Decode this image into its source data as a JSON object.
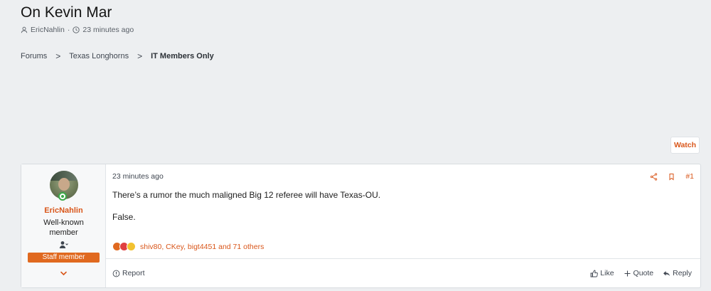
{
  "thread": {
    "title": "On Kevin Mar",
    "author": "EricNahlin",
    "meta_sep": "·",
    "time": "23 minutes ago"
  },
  "breadcrumb": {
    "items": [
      "Forums",
      "Texas Longhorns",
      "IT Members Only"
    ],
    "separator": ">"
  },
  "watch_label": "Watch",
  "post": {
    "user": {
      "name": "EricNahlin",
      "title": "Well-known member",
      "badge": "Staff member"
    },
    "date": "23 minutes ago",
    "number": "#1",
    "body": [
      "There’s a rumor the much maligned Big 12 referee will have Texas-OU.",
      "False."
    ],
    "reactions_text": "shiv80, CKey, bigt4451 and 71 others",
    "report_label": "Report",
    "actions": {
      "like": "Like",
      "quote": "Quote",
      "reply": "Reply"
    }
  },
  "colors": {
    "accent": "#d9561a",
    "staff_badge": "#e0691f",
    "background": "#edeff1"
  },
  "icons": [
    "user-icon",
    "clock-icon",
    "share-icon",
    "bookmark-icon",
    "thumbs-up-icon",
    "plus-icon",
    "reply-icon",
    "report-icon",
    "chevron-down-icon"
  ]
}
